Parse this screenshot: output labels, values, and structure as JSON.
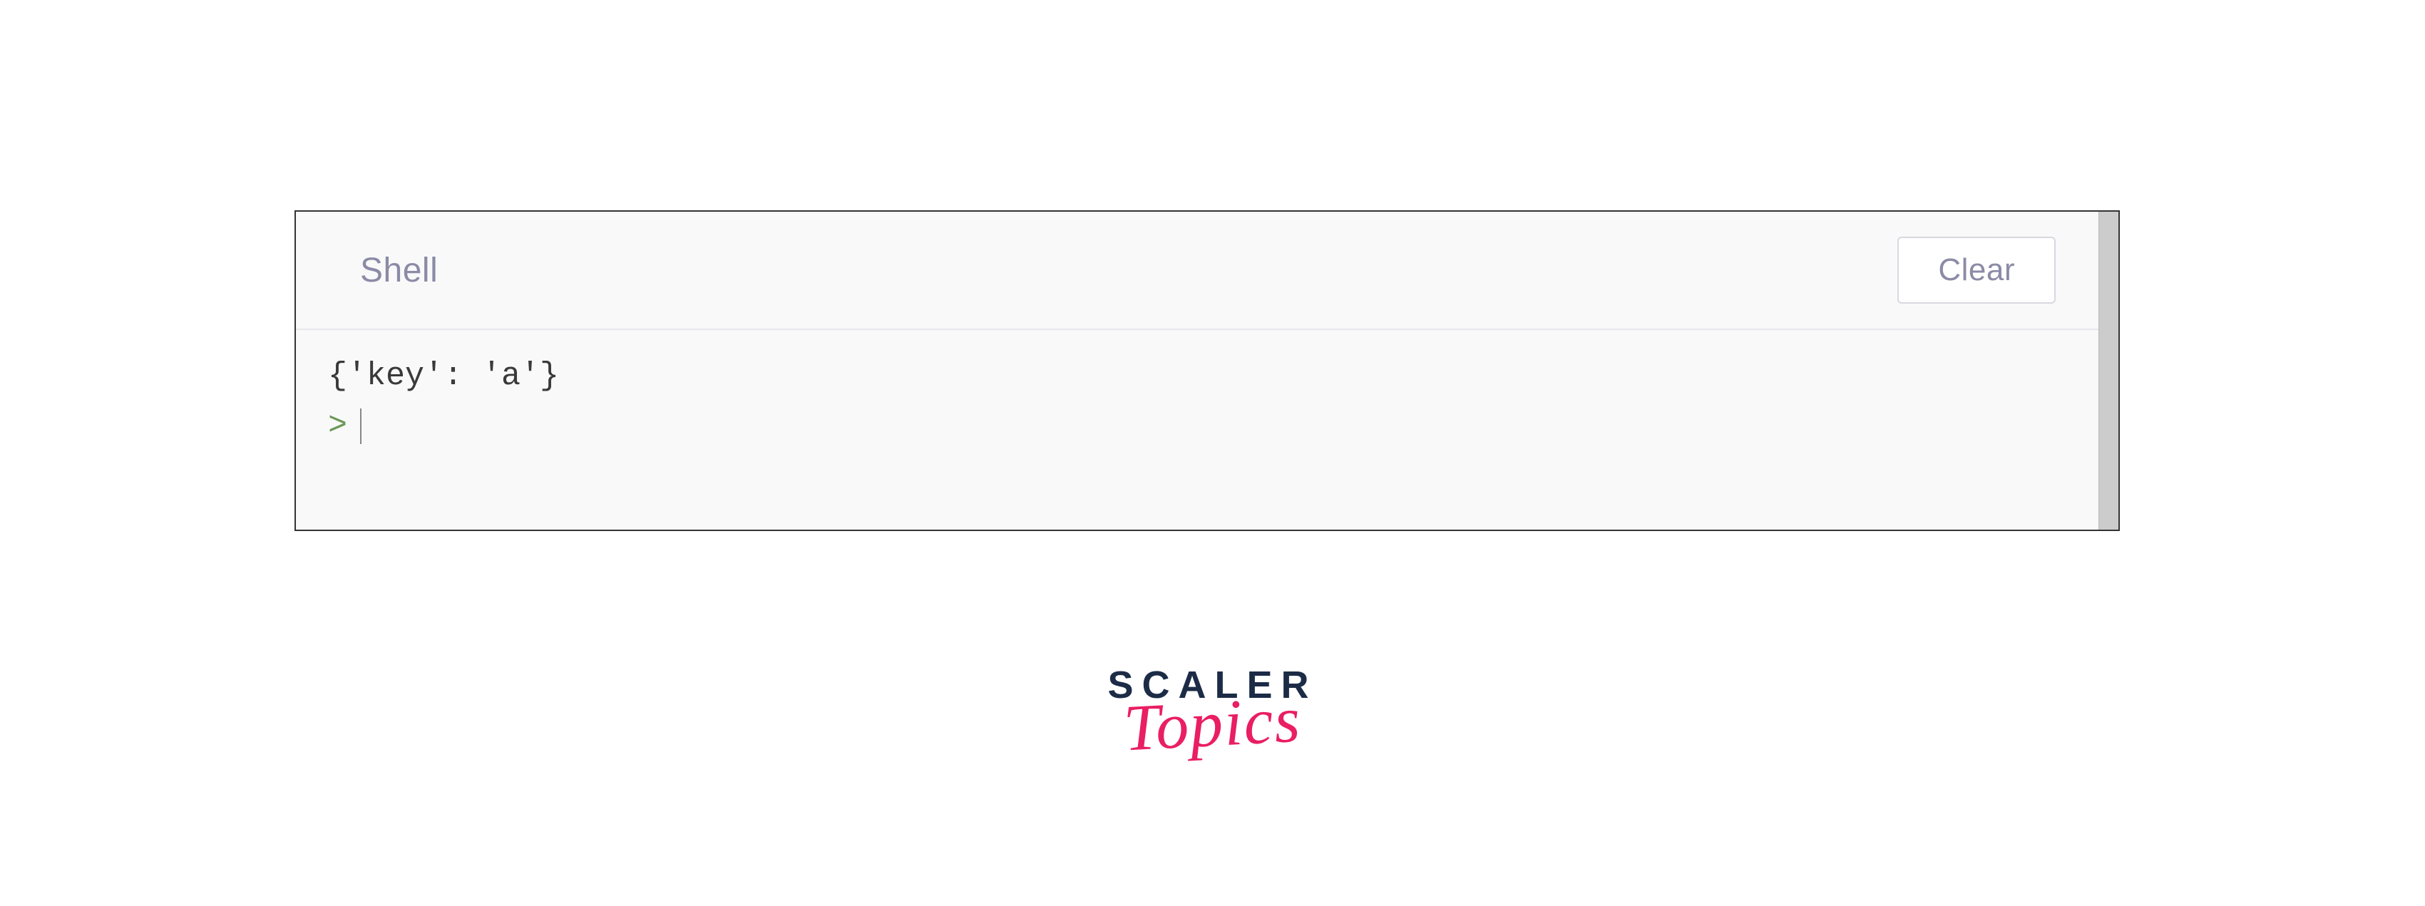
{
  "shell": {
    "title": "Shell",
    "clear_label": "Clear",
    "output_line": "{'key': 'a'}",
    "prompt_symbol": ">"
  },
  "logo": {
    "brand": "SCALER",
    "subbrand": "Topics"
  }
}
